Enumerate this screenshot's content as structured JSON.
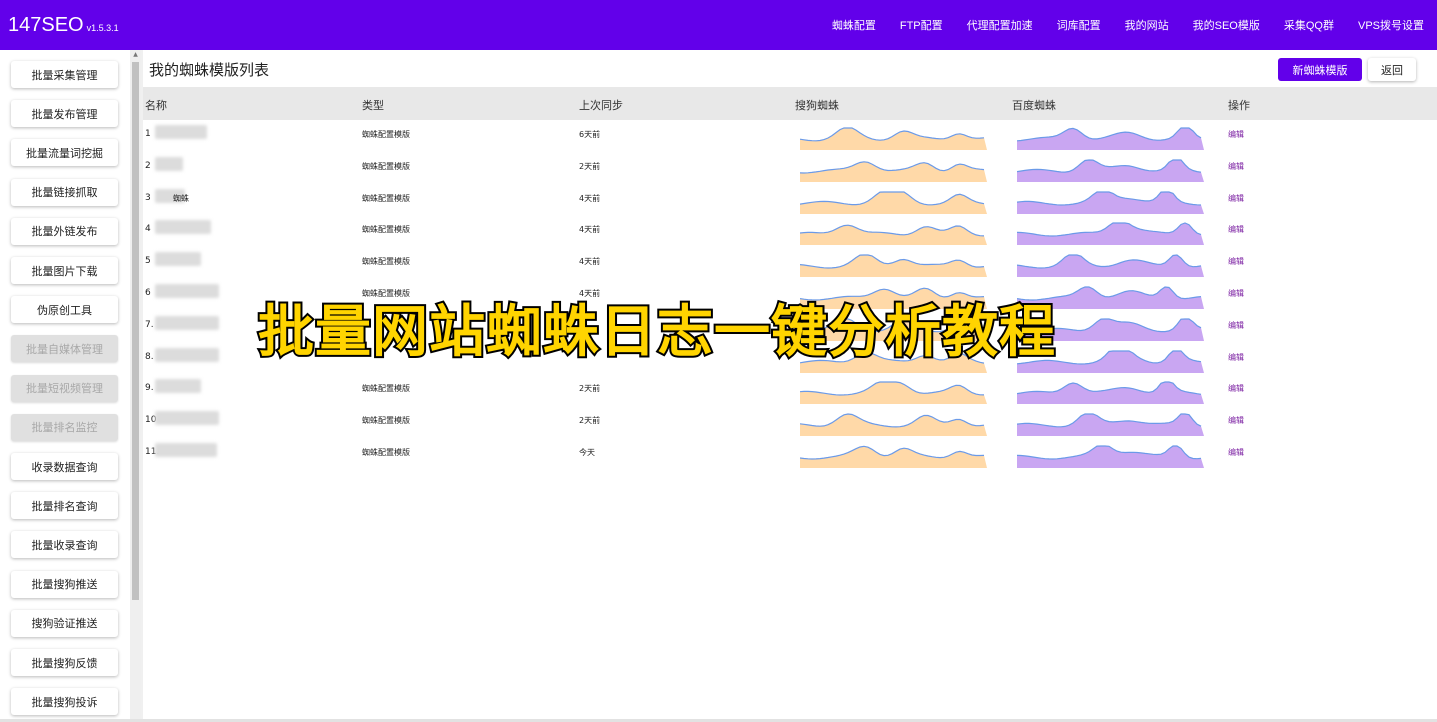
{
  "app": {
    "name": "147SEO",
    "version": "v1.5.3.1"
  },
  "nav": [
    "蜘蛛配置",
    "FTP配置",
    "代理配置加速",
    "词库配置",
    "我的网站",
    "我的SEO模版",
    "采集QQ群",
    "VPS拨号设置"
  ],
  "sidebar": [
    {
      "label": "批量采集管理",
      "disabled": false
    },
    {
      "label": "批量发布管理",
      "disabled": false
    },
    {
      "label": "批量流量词挖掘",
      "disabled": false
    },
    {
      "label": "批量链接抓取",
      "disabled": false
    },
    {
      "label": "批量外链发布",
      "disabled": false
    },
    {
      "label": "批量图片下载",
      "disabled": false
    },
    {
      "label": "伪原创工具",
      "disabled": false
    },
    {
      "label": "批量自媒体管理",
      "disabled": true
    },
    {
      "label": "批量短视频管理",
      "disabled": true
    },
    {
      "label": "批量排名监控",
      "disabled": true
    },
    {
      "label": "收录数据查询",
      "disabled": false
    },
    {
      "label": "批量排名查询",
      "disabled": false
    },
    {
      "label": "批量收录查询",
      "disabled": false
    },
    {
      "label": "批量搜狗推送",
      "disabled": false
    },
    {
      "label": "搜狗验证推送",
      "disabled": false
    },
    {
      "label": "批量搜狗反馈",
      "disabled": false
    },
    {
      "label": "批量搜狗投诉",
      "disabled": false
    }
  ],
  "main": {
    "title": "我的蜘蛛模版列表",
    "new_button": "新蜘蛛模版",
    "back_button": "返回",
    "columns": [
      "名称",
      "类型",
      "上次同步",
      "搜狗蜘蛛",
      "百度蜘蛛",
      "操作"
    ],
    "edit_label": "编辑",
    "rows": [
      {
        "no": "1",
        "name_suffix": "",
        "type": "蜘蛛配置模版",
        "last_sync": "6天前"
      },
      {
        "no": "2",
        "name_suffix": "",
        "type": "蜘蛛配置模版",
        "last_sync": "2天前"
      },
      {
        "no": "3",
        "name_suffix": "蜘蛛",
        "type": "蜘蛛配置模版",
        "last_sync": "4天前"
      },
      {
        "no": "4",
        "name_suffix": "",
        "type": "蜘蛛配置模版",
        "last_sync": "4天前"
      },
      {
        "no": "5",
        "name_suffix": "",
        "type": "蜘蛛配置模版",
        "last_sync": "4天前"
      },
      {
        "no": "6",
        "name_suffix": "",
        "type": "蜘蛛配置模版",
        "last_sync": "4天前"
      },
      {
        "no": "7.",
        "name_suffix": "",
        "type": "",
        "last_sync": ""
      },
      {
        "no": "8.",
        "name_suffix": "",
        "type": "",
        "last_sync": ""
      },
      {
        "no": "9.",
        "name_suffix": "",
        "type": "蜘蛛配置模版",
        "last_sync": "2天前"
      },
      {
        "no": "10",
        "name_suffix": "",
        "type": "蜘蛛配置模版",
        "last_sync": "2天前"
      },
      {
        "no": "11.",
        "name_suffix": "",
        "type": "蜘蛛配置模版",
        "last_sync": "今天"
      }
    ]
  },
  "overlay_caption": "批量网站蜘蛛日志一键分析教程",
  "colors": {
    "brand": "#6200ea",
    "sogou_fill": "#ffd9a8",
    "baidu_fill": "#c9a6f2",
    "line": "#6b9ae8"
  }
}
